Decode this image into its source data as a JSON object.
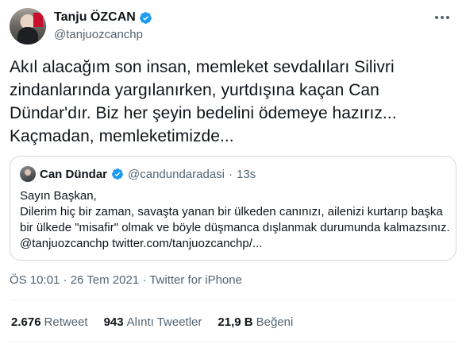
{
  "author": {
    "name": "Tanju ÖZCAN",
    "handle": "@tanjuozcanchp",
    "verified": true
  },
  "tweet": {
    "lines": [
      "Akıl alacağım son insan, memleket sevdalıları Silivri",
      "zindanlarında yargılanırken, yurtdışına kaçan Can",
      "Dündar'dır. Biz her şeyin bedelini ödemeye hazırız...",
      "Kaçmadan, memleketimizde..."
    ]
  },
  "quoted": {
    "name": "Can Dündar",
    "handle": "@candundaradasi",
    "dot": "·",
    "time": "13s",
    "lines": [
      "Sayın Başkan,",
      "Dilerim hiç bir zaman, savaşta yanan bir ülkeden canınızı, ailenizi kurtarıp başka",
      "bir ülkede \"misafir\" olmak ve böyle düşmanca dışlanmak durumunda kalmazsınız.",
      "@tanjuozcanchp twitter.com/tanjuozcanchp/..."
    ]
  },
  "meta": {
    "text": "ÖS 10:01 · 26 Tem 2021 · Twitter for iPhone"
  },
  "stats": [
    {
      "value": "2.676",
      "label": "Retweet"
    },
    {
      "value": "943",
      "label": "Alıntı Tweetler"
    },
    {
      "value": "21,9 B",
      "label": "Beğeni"
    }
  ],
  "colors": {
    "verified": "#1d9bf0",
    "secondary_text": "#536471",
    "primary_text": "#0f1419",
    "border": "#cfd9de"
  },
  "icons": {
    "verified": "verified-badge-icon",
    "more": "more-options-icon"
  }
}
